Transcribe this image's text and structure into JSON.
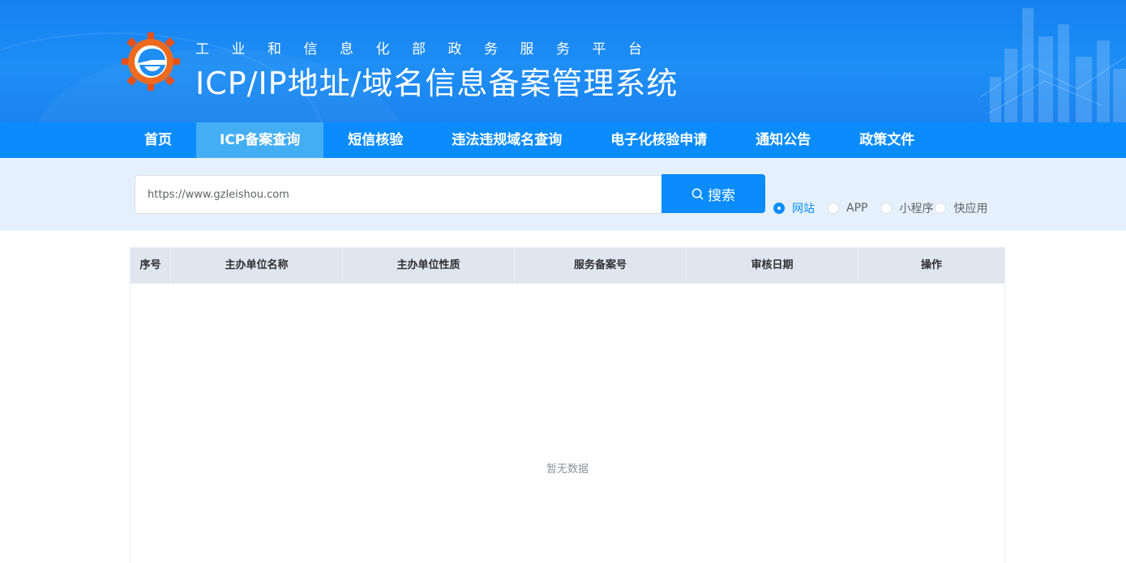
{
  "header": {
    "subtitle": "工业和信息化部政务服务平台",
    "title": "ICP/IP地址/域名信息备案管理系统"
  },
  "nav": {
    "items": [
      {
        "label": "首页"
      },
      {
        "label": "ICP备案查询",
        "active": true
      },
      {
        "label": "短信核验"
      },
      {
        "label": "违法违规域名查询"
      },
      {
        "label": "电子化核验申请"
      },
      {
        "label": "通知公告"
      },
      {
        "label": "政策文件"
      }
    ]
  },
  "search": {
    "value": "https://www.gzleishou.com",
    "button_label": "搜索",
    "types": [
      {
        "label": "网站",
        "checked": true
      },
      {
        "label": "APP"
      },
      {
        "label": "小程序"
      },
      {
        "label": "快应用"
      }
    ]
  },
  "table": {
    "columns": [
      "序号",
      "主办单位名称",
      "主办单位性质",
      "服务备案号",
      "审核日期",
      "操作"
    ],
    "empty_text": "暂无数据"
  },
  "colors": {
    "primary": "#0a8cff",
    "nav_active": "#44aef5",
    "search_band": "#e4f1fd",
    "table_header": "#e0e5ef"
  }
}
